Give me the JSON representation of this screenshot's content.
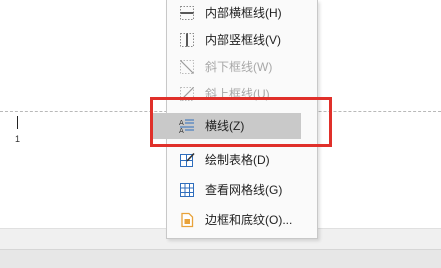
{
  "document": {
    "line_number": "1"
  },
  "menu": {
    "items": [
      {
        "label": "内部横框线(H)",
        "icon": "inside-horizontal-border-icon",
        "enabled": true
      },
      {
        "label": "内部竖框线(V)",
        "icon": "inside-vertical-border-icon",
        "enabled": true
      },
      {
        "label": "斜下框线(W)",
        "icon": "diagonal-down-border-icon",
        "enabled": false
      },
      {
        "label": "斜上框线(U)",
        "icon": "diagonal-up-border-icon",
        "enabled": false
      },
      {
        "label": "横线(Z)",
        "icon": "horizontal-line-icon",
        "enabled": true,
        "highlighted": true
      },
      {
        "label": "绘制表格(D)",
        "icon": "draw-table-icon",
        "enabled": true
      },
      {
        "label": "查看网格线(G)",
        "icon": "view-gridlines-icon",
        "enabled": true
      },
      {
        "label": "边框和底纹(O)...",
        "icon": "borders-shading-icon",
        "enabled": true
      }
    ]
  },
  "colors": {
    "highlight_box": "#e0302a",
    "menu_hover": "#c9c9c9",
    "icon_blue": "#2f6ebd",
    "icon_orange": "#e8a23a"
  }
}
